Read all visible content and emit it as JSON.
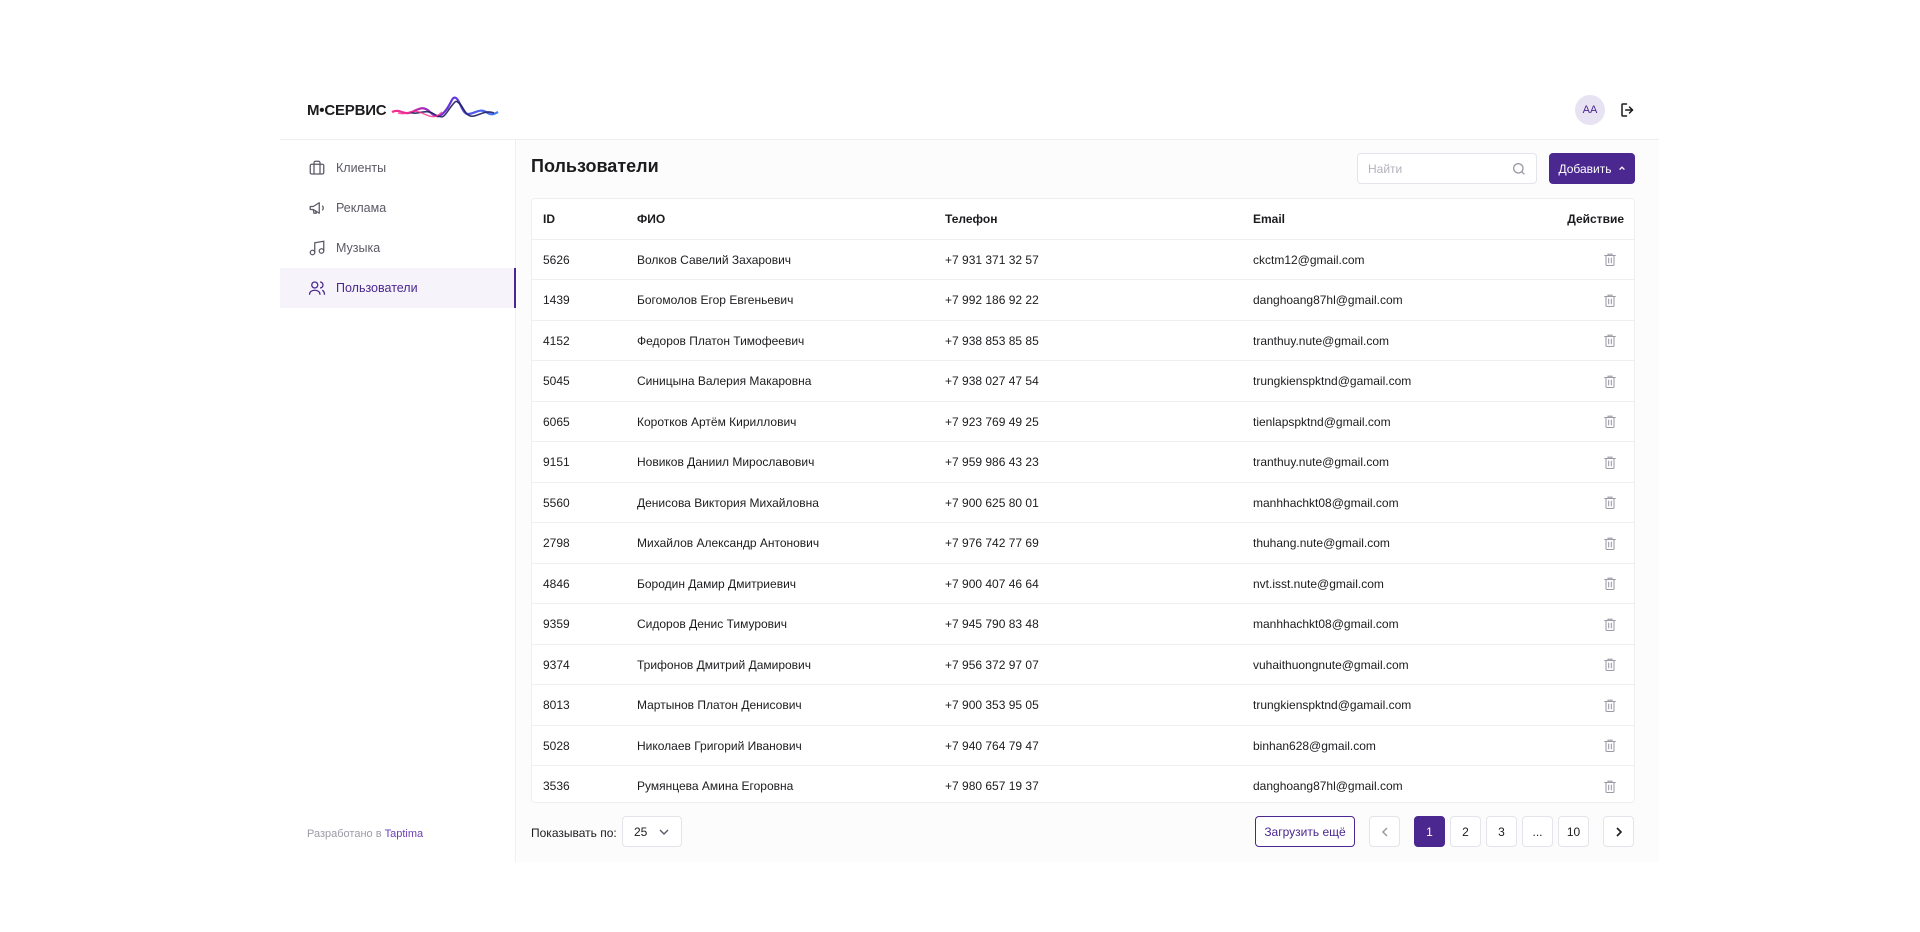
{
  "header": {
    "logo_text": "М•СЕРВИС",
    "avatar_initials": "АА"
  },
  "sidebar": {
    "items": [
      {
        "label": "Клиенты",
        "icon": "briefcase-icon"
      },
      {
        "label": "Реклама",
        "icon": "megaphone-icon"
      },
      {
        "label": "Музыка",
        "icon": "music-note-icon"
      },
      {
        "label": "Пользователи",
        "icon": "users-icon",
        "active": true
      }
    ],
    "footer_prefix": "Разработано в",
    "footer_link": "Taptima"
  },
  "main": {
    "title": "Пользователи",
    "search_placeholder": "Найти",
    "add_label": "Добавить"
  },
  "table": {
    "headers": {
      "id": "ID",
      "fio": "ФИО",
      "phone": "Телефон",
      "email": "Email",
      "action": "Действие"
    },
    "rows": [
      {
        "id": "5626",
        "fio": "Волков Савелий Захарович",
        "phone": "+7 931 371 32 57",
        "email": "ckctm12@gmail.com"
      },
      {
        "id": "1439",
        "fio": "Богомолов Егор Евгеньевич",
        "phone": "+7 992 186 92 22",
        "email": "danghoang87hl@gmail.com"
      },
      {
        "id": "4152",
        "fio": "Федоров Платон Тимофеевич",
        "phone": "+7 938 853 85 85",
        "email": "tranthuy.nute@gmail.com"
      },
      {
        "id": "5045",
        "fio": "Синицына Валерия Макаровна",
        "phone": "+7 938 027 47 54",
        "email": "trungkienspktnd@gamail.com"
      },
      {
        "id": "6065",
        "fio": "Коротков Артём Кириллович",
        "phone": "+7 923 769 49 25",
        "email": "tienlapspktnd@gmail.com"
      },
      {
        "id": "9151",
        "fio": "Новиков Даниил Мирославович",
        "phone": "+7 959 986 43 23",
        "email": "tranthuy.nute@gmail.com"
      },
      {
        "id": "5560",
        "fio": "Денисова Виктория Михайловна",
        "phone": "+7 900 625 80 01",
        "email": "manhhachkt08@gmail.com"
      },
      {
        "id": "2798",
        "fio": "Михайлов Александр Антонович",
        "phone": "+7 976 742 77 69",
        "email": "thuhang.nute@gmail.com"
      },
      {
        "id": "4846",
        "fio": "Бородин Дамир Дмитриевич",
        "phone": "+7 900 407 46 64",
        "email": "nvt.isst.nute@gmail.com"
      },
      {
        "id": "9359",
        "fio": "Сидоров Денис Тимурович",
        "phone": "+7 945 790 83 48",
        "email": "manhhachkt08@gmail.com"
      },
      {
        "id": "9374",
        "fio": "Трифонов Дмитрий Дамирович",
        "phone": "+7 956 372 97 07",
        "email": "vuhaithuongnute@gmail.com"
      },
      {
        "id": "8013",
        "fio": "Мартынов Платон Денисович",
        "phone": "+7 900 353 95 05",
        "email": "trungkienspktnd@gamail.com"
      },
      {
        "id": "5028",
        "fio": "Николаев Григорий Иванович",
        "phone": "+7 940 764 79 47",
        "email": "binhan628@gmail.com"
      },
      {
        "id": "3536",
        "fio": "Румянцева Амина Егоровна",
        "phone": "+7 980 657 19 37",
        "email": "danghoang87hl@gmail.com"
      }
    ]
  },
  "pagination": {
    "per_page_label": "Показывать по:",
    "per_page_value": "25",
    "load_more_label": "Загрузить ещё",
    "pages": [
      "1",
      "2",
      "3",
      "...",
      "10"
    ],
    "current_page": "1"
  },
  "colors": {
    "accent": "#4b2790",
    "active_bg": "#f6f4fa",
    "border": "#efeff2"
  }
}
